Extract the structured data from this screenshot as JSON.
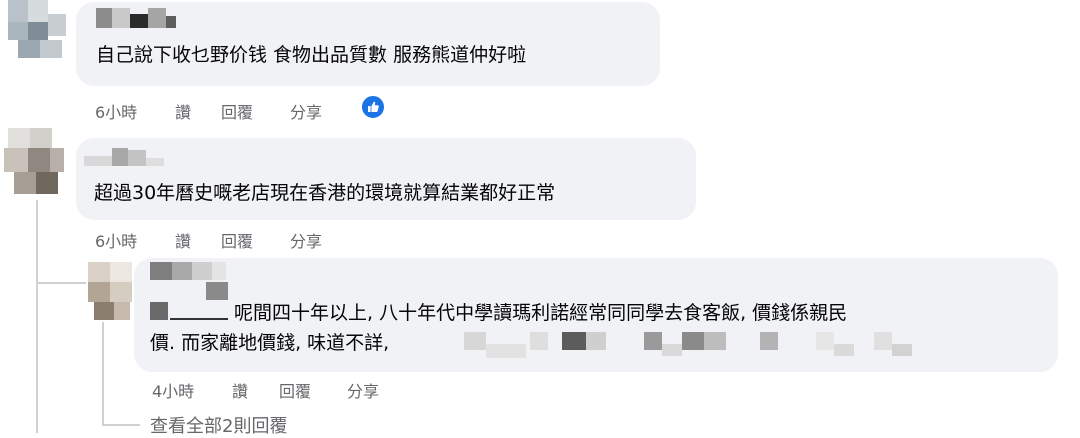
{
  "comments": [
    {
      "text": "自己說下收乜野价钱 食物出品質數 服務熊道仲好啦",
      "actions": {
        "time": "6小時",
        "like": "讚",
        "reply": "回覆",
        "share": "分享"
      },
      "reaction_icon": "thumbs-up-icon"
    },
    {
      "text": "超過30年曆史嘅老店現在香港的環境就算結業都好正常",
      "actions": {
        "time": "6小時",
        "like": "讚",
        "reply": "回覆",
        "share": "分享"
      }
    }
  ],
  "reply": {
    "line1": "呢間四十年以上, 八十年代中學讀瑪利諾經常同同學去食客飯, 價錢係親民",
    "line2": "價. 而家離地價錢, 味道不詳,",
    "actions": {
      "time": "4小時",
      "like": "讚",
      "reply": "回覆",
      "share": "分享"
    }
  },
  "view_more_replies": "查看全部2則回覆",
  "colors": {
    "bubble": "#f0f2f5",
    "meta": "#65676b",
    "like_blue": "#1b74e4"
  }
}
